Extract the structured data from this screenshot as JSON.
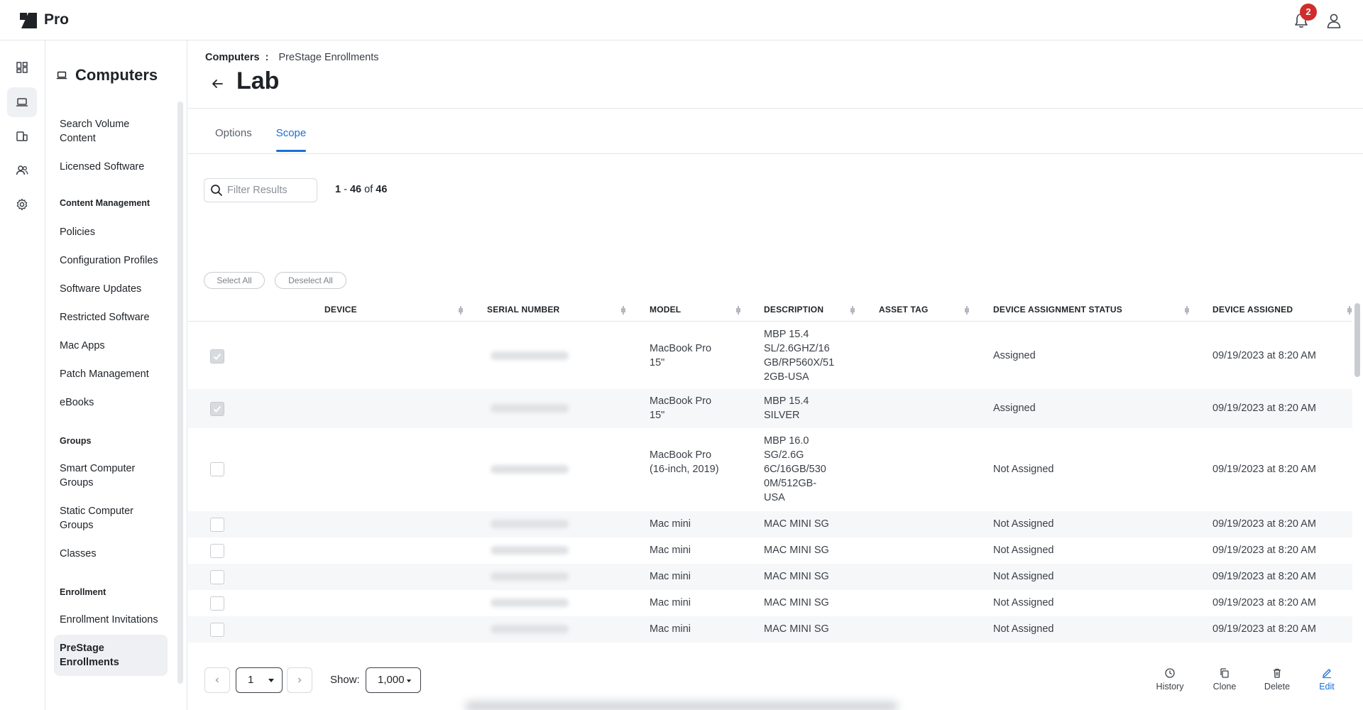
{
  "app": {
    "logo_text": "Pro",
    "notification_count": "2"
  },
  "rail": {
    "icons": [
      "dashboard-icon",
      "computer-icon",
      "devices-icon",
      "users-icon",
      "settings-icon"
    ],
    "active": 1
  },
  "nav": {
    "title": "Computers",
    "items_top": [
      "Search Volume Content",
      "Licensed Software"
    ],
    "section_content": "Content Management",
    "items_content": [
      "Policies",
      "Configuration Profiles",
      "Software Updates",
      "Restricted Software",
      "Mac Apps",
      "Patch Management",
      "eBooks"
    ],
    "section_groups": "Groups",
    "items_groups": [
      "Smart Computer Groups",
      "Static Computer Groups",
      "Classes"
    ],
    "section_enrollment": "Enrollment",
    "items_enrollment": [
      "Enrollment Invitations",
      "PreStage Enrollments"
    ]
  },
  "breadcrumb": {
    "root": "Computers",
    "separator": ":",
    "current": "PreStage Enrollments"
  },
  "page": {
    "title": "Lab"
  },
  "tabs": {
    "options": "Options",
    "scope": "Scope"
  },
  "filter": {
    "placeholder": "Filter Results"
  },
  "count": {
    "start": "1",
    "dash": "-",
    "end": "46",
    "of": "of",
    "total": "46"
  },
  "buttons": {
    "select_all": "Select All",
    "deselect_all": "Deselect All"
  },
  "table": {
    "columns": [
      "DEVICE",
      "SERIAL NUMBER",
      "MODEL",
      "DESCRIPTION",
      "ASSET TAG",
      "DEVICE ASSIGNMENT STATUS",
      "DEVICE ASSIGNED"
    ],
    "rows": [
      {
        "checked": true,
        "model": "MacBook Pro 15\"",
        "description": "MBP 15.4 SL/2.6GHZ/16 GB/RP560X/51 2GB-USA",
        "asset_tag": "",
        "status": "Assigned",
        "assigned": "09/19/2023 at 8:20 AM"
      },
      {
        "checked": true,
        "model": "MacBook Pro 15\"",
        "description": "MBP 15.4 SILVER",
        "asset_tag": "",
        "status": "Assigned",
        "assigned": "09/19/2023 at 8:20 AM"
      },
      {
        "checked": false,
        "model": "MacBook Pro (16-inch, 2019)",
        "description": "MBP 16.0 SG/2.6G 6C/16GB/530 0M/512GB-USA",
        "asset_tag": "",
        "status": "Not Assigned",
        "assigned": "09/19/2023 at 8:20 AM"
      },
      {
        "checked": false,
        "model": "Mac mini",
        "description": "MAC MINI SG",
        "asset_tag": "",
        "status": "Not Assigned",
        "assigned": "09/19/2023 at 8:20 AM"
      },
      {
        "checked": false,
        "model": "Mac mini",
        "description": "MAC MINI SG",
        "asset_tag": "",
        "status": "Not Assigned",
        "assigned": "09/19/2023 at 8:20 AM"
      },
      {
        "checked": false,
        "model": "Mac mini",
        "description": "MAC MINI SG",
        "asset_tag": "",
        "status": "Not Assigned",
        "assigned": "09/19/2023 at 8:20 AM"
      },
      {
        "checked": false,
        "model": "Mac mini",
        "description": "MAC MINI SG",
        "asset_tag": "",
        "status": "Not Assigned",
        "assigned": "09/19/2023 at 8:20 AM"
      },
      {
        "checked": false,
        "model": "Mac mini",
        "description": "MAC MINI SG",
        "asset_tag": "",
        "status": "Not Assigned",
        "assigned": "09/19/2023 at 8:20 AM"
      }
    ]
  },
  "pager": {
    "page": "1",
    "show_label": "Show:",
    "show_value": "1,000"
  },
  "actions": {
    "history": "History",
    "clone": "Clone",
    "delete": "Delete",
    "edit": "Edit"
  },
  "colors": {
    "accent": "#1a6fd6",
    "badge": "#d12c2c"
  }
}
